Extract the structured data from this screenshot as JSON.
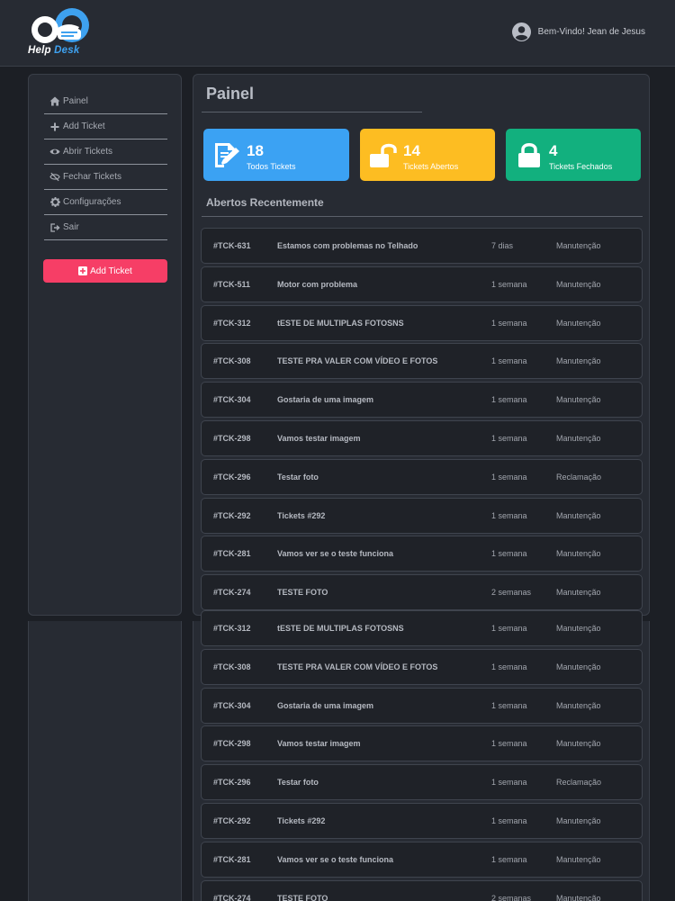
{
  "brand": {
    "name_part1": "Help",
    "name_part2": "Desk"
  },
  "user": {
    "greeting": "Bem-Vindo! Jean de Jesus",
    "avatar_icon": "user-circle-icon"
  },
  "sidebar": {
    "items": [
      {
        "label": "Painel",
        "icon": "home-icon"
      },
      {
        "label": "Add Ticket",
        "icon": "plus-icon"
      },
      {
        "label": "Abrir Tickets",
        "icon": "eye-icon"
      },
      {
        "label": "Fechar Tickets",
        "icon": "eye-slash-icon"
      },
      {
        "label": "Configurações",
        "icon": "gear-icon"
      },
      {
        "label": "Sair",
        "icon": "sign-out-icon"
      }
    ],
    "add_button_label": "Add Ticket"
  },
  "page": {
    "title": "Painel",
    "section_title": "Abertos Recentemente"
  },
  "cards": [
    {
      "count": "18",
      "label": "Todos Tickets",
      "color": "#3ba2f3",
      "icon": "edit-document-icon"
    },
    {
      "count": "14",
      "label": "Tickets Abertos",
      "color": "#fdbd22",
      "icon": "unlock-icon"
    },
    {
      "count": "4",
      "label": "Tickets Fechados",
      "color": "#12b07e",
      "icon": "lock-icon"
    }
  ],
  "tickets": [
    {
      "id": "#TCK-631",
      "title": "Estamos com problemas no Telhado",
      "time": "7 dias",
      "category": "Manutenção"
    },
    {
      "id": "#TCK-511",
      "title": "Motor com problema",
      "time": "1 semana",
      "category": "Manutenção"
    },
    {
      "id": "#TCK-312",
      "title": "tESTE DE MULTIPLAS FOTOSNS",
      "time": "1 semana",
      "category": "Manutenção"
    },
    {
      "id": "#TCK-308",
      "title": "TESTE PRA VALER COM VÍDEO E FOTOS",
      "time": "1 semana",
      "category": "Manutenção"
    },
    {
      "id": "#TCK-304",
      "title": "Gostaria de uma imagem",
      "time": "1 semana",
      "category": "Manutenção"
    },
    {
      "id": "#TCK-298",
      "title": "Vamos testar imagem",
      "time": "1 semana",
      "category": "Manutenção"
    },
    {
      "id": "#TCK-296",
      "title": "Testar foto",
      "time": "1 semana",
      "category": "Reclamação"
    },
    {
      "id": "#TCK-292",
      "title": "Tickets #292",
      "time": "1 semana",
      "category": "Manutenção"
    },
    {
      "id": "#TCK-281",
      "title": "Vamos ver se o teste funciona",
      "time": "1 semana",
      "category": "Manutenção"
    },
    {
      "id": "#TCK-274",
      "title": "TESTE FOTO",
      "time": "2 semanas",
      "category": "Manutenção"
    }
  ],
  "tickets_overflow": [
    {
      "id": "#TCK-312",
      "title": "tESTE DE MULTIPLAS FOTOSNS",
      "time": "1 semana",
      "category": "Manutenção"
    },
    {
      "id": "#TCK-308",
      "title": "TESTE PRA VALER COM VÍDEO E FOTOS",
      "time": "1 semana",
      "category": "Manutenção"
    },
    {
      "id": "#TCK-304",
      "title": "Gostaria de uma imagem",
      "time": "1 semana",
      "category": "Manutenção"
    },
    {
      "id": "#TCK-298",
      "title": "Vamos testar imagem",
      "time": "1 semana",
      "category": "Manutenção"
    },
    {
      "id": "#TCK-296",
      "title": "Testar foto",
      "time": "1 semana",
      "category": "Reclamação"
    },
    {
      "id": "#TCK-292",
      "title": "Tickets #292",
      "time": "1 semana",
      "category": "Manutenção"
    },
    {
      "id": "#TCK-281",
      "title": "Vamos ver se o teste funciona",
      "time": "1 semana",
      "category": "Manutenção"
    },
    {
      "id": "#TCK-274",
      "title": "TESTE FOTO",
      "time": "2 semanas",
      "category": "Manutenção"
    }
  ]
}
